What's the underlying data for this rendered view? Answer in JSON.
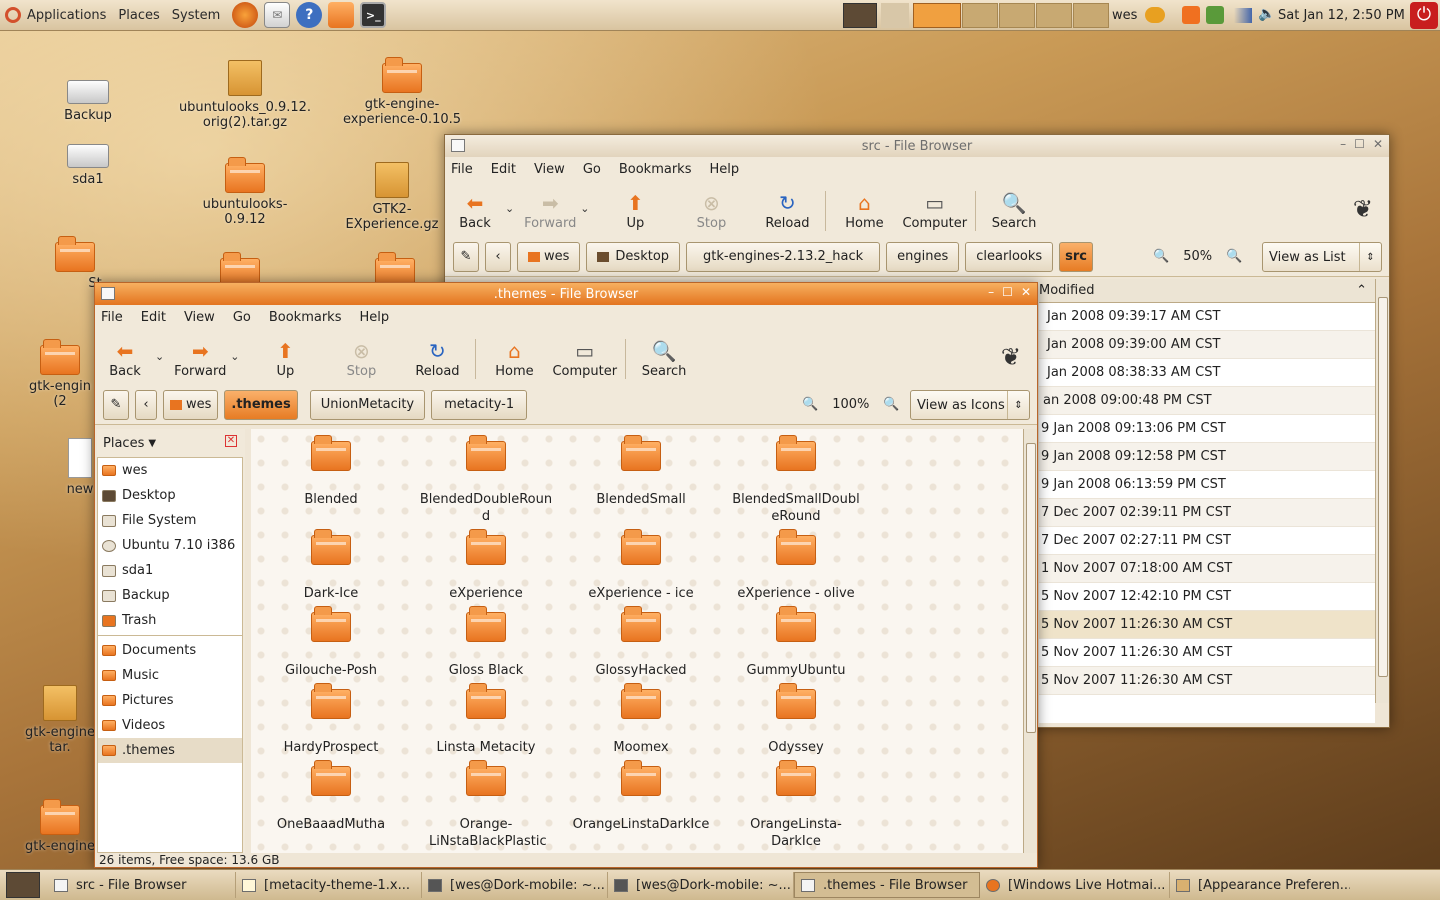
{
  "top_panel": {
    "menus": [
      "Applications",
      "Places",
      "System"
    ],
    "user": "wes",
    "clock": "Sat Jan 12,  2:50 PM"
  },
  "desktop_icons": [
    {
      "label": "Backup"
    },
    {
      "label": "sda1"
    },
    {
      "label": "ubuntulooks_0.9.12.orig(2).tar.gz"
    },
    {
      "label": "ubuntulooks-0.9.12"
    },
    {
      "label": "gtk-engine-experience-0.10.5"
    },
    {
      "label": "GTK2-EXperience.gz"
    },
    {
      "label": "St"
    },
    {
      "label": "gtk-engin (2"
    },
    {
      "label": "new"
    },
    {
      "label": "gtk-engine tar."
    },
    {
      "label": "gtk-engine"
    }
  ],
  "back_window": {
    "title": "src - File Browser",
    "menus": [
      "File",
      "Edit",
      "View",
      "Go",
      "Bookmarks",
      "Help"
    ],
    "toolbar": {
      "back": "Back",
      "forward": "Forward",
      "up": "Up",
      "stop": "Stop",
      "reload": "Reload",
      "home": "Home",
      "computer": "Computer",
      "search": "Search"
    },
    "crumbs": [
      "wes",
      "Desktop",
      "gtk-engines-2.13.2_hack",
      "engines",
      "clearlooks",
      "src"
    ],
    "zoom": "50%",
    "view_mode": "View as List",
    "column_header": "Modified",
    "rows": [
      "Jan 2008 09:39:17 AM CST",
      "Jan 2008 09:39:00 AM CST",
      "Jan 2008 08:38:33 AM CST",
      "an 2008 09:00:48 PM CST",
      "9 Jan 2008 09:13:06 PM CST",
      "9 Jan 2008 09:12:58 PM CST",
      "9 Jan 2008 06:13:59 PM CST",
      "7 Dec 2007 02:39:11 PM CST",
      "7 Dec 2007 02:27:11 PM CST",
      "1 Nov 2007 07:18:00 AM CST",
      "5 Nov 2007 12:42:10 PM CST",
      "5 Nov 2007 11:26:30 AM CST",
      "5 Nov 2007 11:26:30 AM CST",
      "5 Nov 2007 11:26:30 AM CST"
    ]
  },
  "front_window": {
    "title": ".themes - File Browser",
    "menus": [
      "File",
      "Edit",
      "View",
      "Go",
      "Bookmarks",
      "Help"
    ],
    "toolbar": {
      "back": "Back",
      "forward": "Forward",
      "up": "Up",
      "stop": "Stop",
      "reload": "Reload",
      "home": "Home",
      "computer": "Computer",
      "search": "Search"
    },
    "crumbs": [
      "wes",
      ".themes",
      "UnionMetacity",
      "metacity-1"
    ],
    "zoom": "100%",
    "view_mode": "View as Icons",
    "sidebar_title": "Places",
    "places": [
      "wes",
      "Desktop",
      "File System",
      "Ubuntu 7.10 i386",
      "sda1",
      "Backup",
      "Trash"
    ],
    "bookmarks": [
      "Documents",
      "Music",
      "Pictures",
      "Videos",
      ".themes"
    ],
    "folders": [
      "Blended",
      "BlendedDoubleRound",
      "BlendedSmall",
      "BlendedSmallDoubleRound",
      "Dark-Ice",
      "eXperience",
      "eXperience - ice",
      "eXperience - olive",
      "Gilouche-Posh",
      "Gloss Black",
      "GlossyHacked",
      "GummyUbuntu",
      "HardyProspect",
      "Linsta Metacity",
      "Moomex",
      "Odyssey",
      "OneBaaadMutha",
      "Orange-LiNstaBlackPlastic",
      "OrangeLinstaDarkIce",
      "OrangeLinsta-DarkIce"
    ],
    "status": "26 items, Free space: 13.6 GB"
  },
  "taskbar": [
    "src - File Browser",
    "[metacity-theme-1.x...",
    "[wes@Dork-mobile: ~...",
    "[wes@Dork-mobile: ~...",
    ".themes - File Browser",
    "[Windows Live Hotmai...",
    "[Appearance Preferen..."
  ],
  "colors": {
    "accent": "#e77c24",
    "panel": "#e2d0ae",
    "window_bg": "#efe6d6"
  }
}
